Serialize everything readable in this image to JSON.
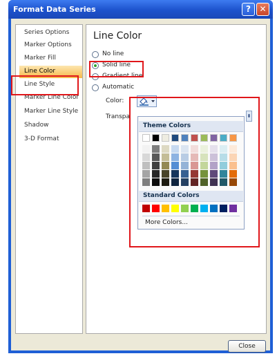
{
  "window": {
    "title": "Format Data Series",
    "help_glyph": "?",
    "close_glyph": "✕"
  },
  "sidebar": {
    "items": [
      {
        "label": "Series Options",
        "selected": false
      },
      {
        "label": "Marker Options",
        "selected": false
      },
      {
        "label": "Marker Fill",
        "selected": false
      },
      {
        "label": "Line Color",
        "selected": true
      },
      {
        "label": "Line Style",
        "selected": false
      },
      {
        "label": "Marker Line Color",
        "selected": false
      },
      {
        "label": "Marker Line Style",
        "selected": false
      },
      {
        "label": "Shadow",
        "selected": false
      },
      {
        "label": "3-D Format",
        "selected": false
      }
    ]
  },
  "panel": {
    "title": "Line Color",
    "options": [
      {
        "label": "No line",
        "checked": false
      },
      {
        "label": "Solid line",
        "checked": true
      },
      {
        "label": "Gradient line",
        "checked": false
      },
      {
        "label": "Automatic",
        "checked": false
      }
    ],
    "color_label": "Color:",
    "color_icon": "paint-bucket-icon",
    "transparency_label": "Transpa"
  },
  "color_picker": {
    "theme_header": "Theme Colors",
    "theme_colors": [
      "#ffffff",
      "#000000",
      "#eeece1",
      "#1f497d",
      "#4f81bd",
      "#c0504d",
      "#9bbb59",
      "#8064a2",
      "#4bacc6",
      "#f79646"
    ],
    "theme_shades": [
      [
        "#f2f2f2",
        "#7f7f7f",
        "#ddd9c3",
        "#c6d9f0",
        "#dbe5f1",
        "#f2dcdb",
        "#ebf1dd",
        "#e5e0ec",
        "#dbeef3",
        "#fdeada"
      ],
      [
        "#d8d8d8",
        "#595959",
        "#c4bd97",
        "#8db3e2",
        "#b8cce4",
        "#e5b9b7",
        "#d7e3bc",
        "#ccc1d9",
        "#b7dde8",
        "#fbd5b5"
      ],
      [
        "#bfbfbf",
        "#3f3f3f",
        "#938953",
        "#548dd4",
        "#95b3d7",
        "#d99694",
        "#c3d69b",
        "#b2a2c7",
        "#92cddc",
        "#fac08f"
      ],
      [
        "#a5a5a5",
        "#262626",
        "#494429",
        "#17365d",
        "#366092",
        "#953734",
        "#76923c",
        "#5f497a",
        "#31859b",
        "#e36c09"
      ],
      [
        "#7f7f7f",
        "#0c0c0c",
        "#1d1b10",
        "#0f243e",
        "#244061",
        "#632423",
        "#4f6128",
        "#3f3151",
        "#205867",
        "#974806"
      ]
    ],
    "standard_header": "Standard Colors",
    "standard_colors": [
      "#c00000",
      "#ff0000",
      "#ffc000",
      "#ffff00",
      "#92d050",
      "#00b050",
      "#00b0f0",
      "#0070c0",
      "#002060",
      "#7030a0"
    ],
    "more_colors": "More Colors..."
  },
  "footer": {
    "close_label": "Close"
  },
  "accent_colors": {
    "highlight_box": "#e0161a",
    "title_bar": "#1f5fd6"
  }
}
